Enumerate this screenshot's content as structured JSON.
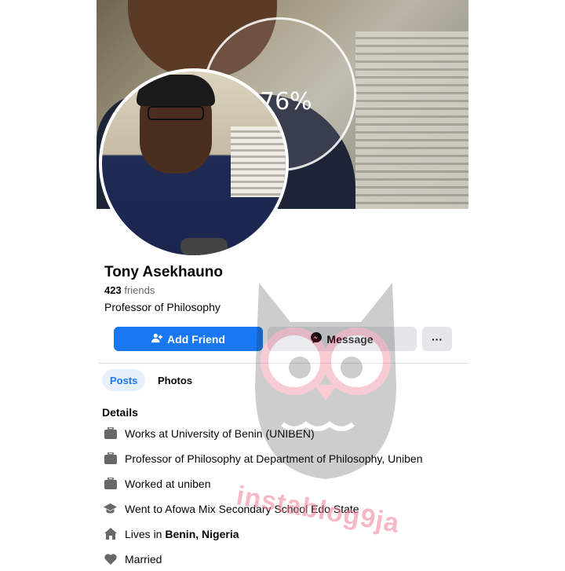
{
  "cover": {
    "progress_text": "76%"
  },
  "profile": {
    "name": "Tony Asekhauno",
    "friends_count": "423",
    "friends_label": "friends",
    "bio": "Professor of Philosophy"
  },
  "actions": {
    "add_friend": "Add Friend",
    "message": "Message",
    "more": "···"
  },
  "tabs": [
    {
      "label": "Posts",
      "active": true
    },
    {
      "label": "Photos",
      "active": false
    }
  ],
  "details": {
    "title": "Details",
    "items": [
      {
        "icon": "briefcase-icon",
        "text": "Works at University of Benin (UNIBEN)"
      },
      {
        "icon": "briefcase-icon",
        "text": "Professor of Philosophy at Department of Philosophy, Uniben"
      },
      {
        "icon": "briefcase-icon",
        "text": "Worked at uniben"
      },
      {
        "icon": "graduation-cap-icon",
        "text": "Went to Afowa Mix Secondary School Edo State"
      },
      {
        "icon": "home-icon",
        "prefix": "Lives in ",
        "bold": "Benin, Nigeria"
      },
      {
        "icon": "heart-icon",
        "text": "Married"
      }
    ]
  },
  "watermark": {
    "text": "instablog9ja"
  },
  "colors": {
    "primary": "#1877f2",
    "secondary_button": "#e4e6eb",
    "tab_active_bg": "#e7f0fc"
  }
}
